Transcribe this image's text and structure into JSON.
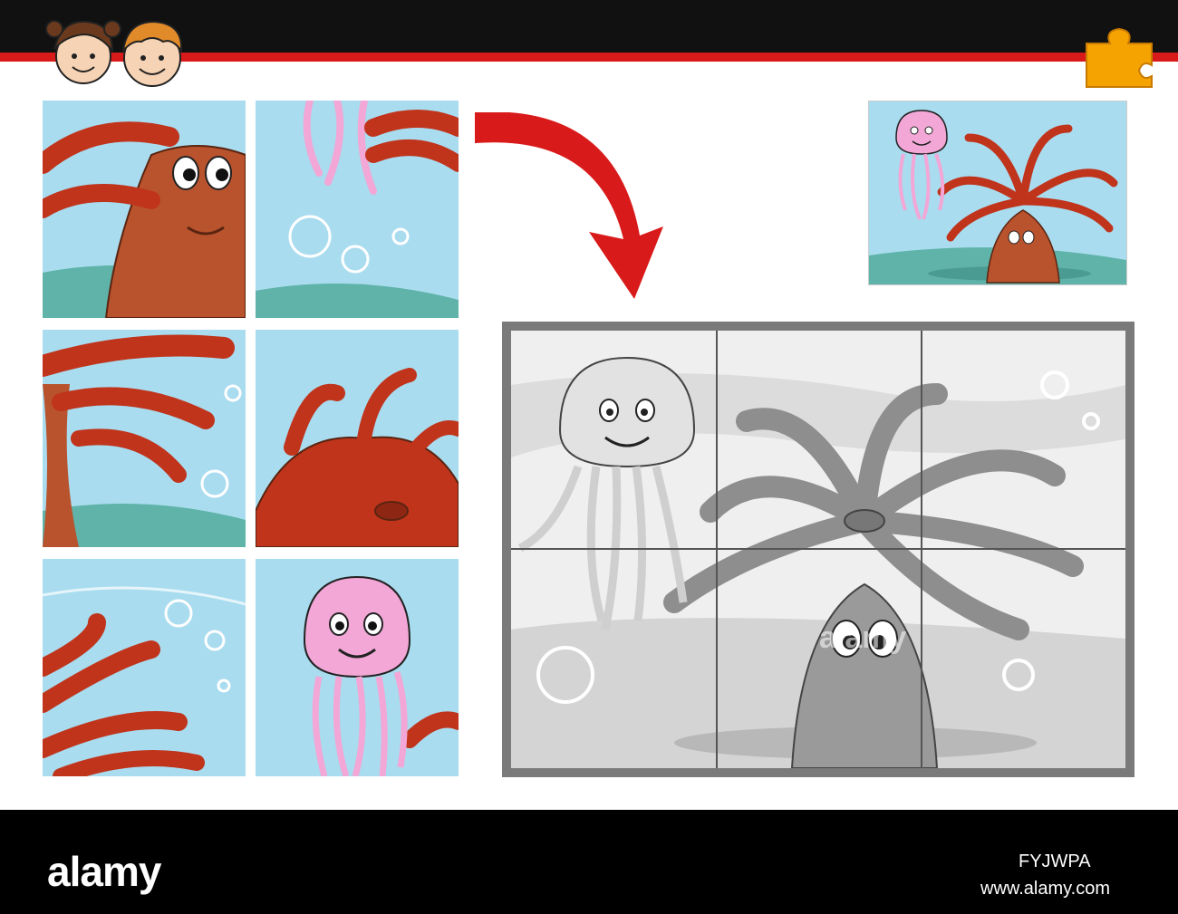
{
  "brand": {
    "logo_text": "alamy",
    "image_id": "FYJWPA",
    "site": "www.alamy.com",
    "watermark": "alamy"
  },
  "colors": {
    "top_bar": "#111111",
    "accent_red": "#d91a1a",
    "puzzle_icon": "#f5a300",
    "water": "#a9dcef",
    "anemone": "#c0341c",
    "jellyfish": "#f2a7d6",
    "board_frame": "#7a7a7a"
  },
  "icons": [
    "kids-faces-icon",
    "puzzle-piece-icon",
    "curved-arrow-icon"
  ],
  "puzzle": {
    "grid_rows": 2,
    "grid_cols": 3,
    "loose_pieces": 6
  }
}
